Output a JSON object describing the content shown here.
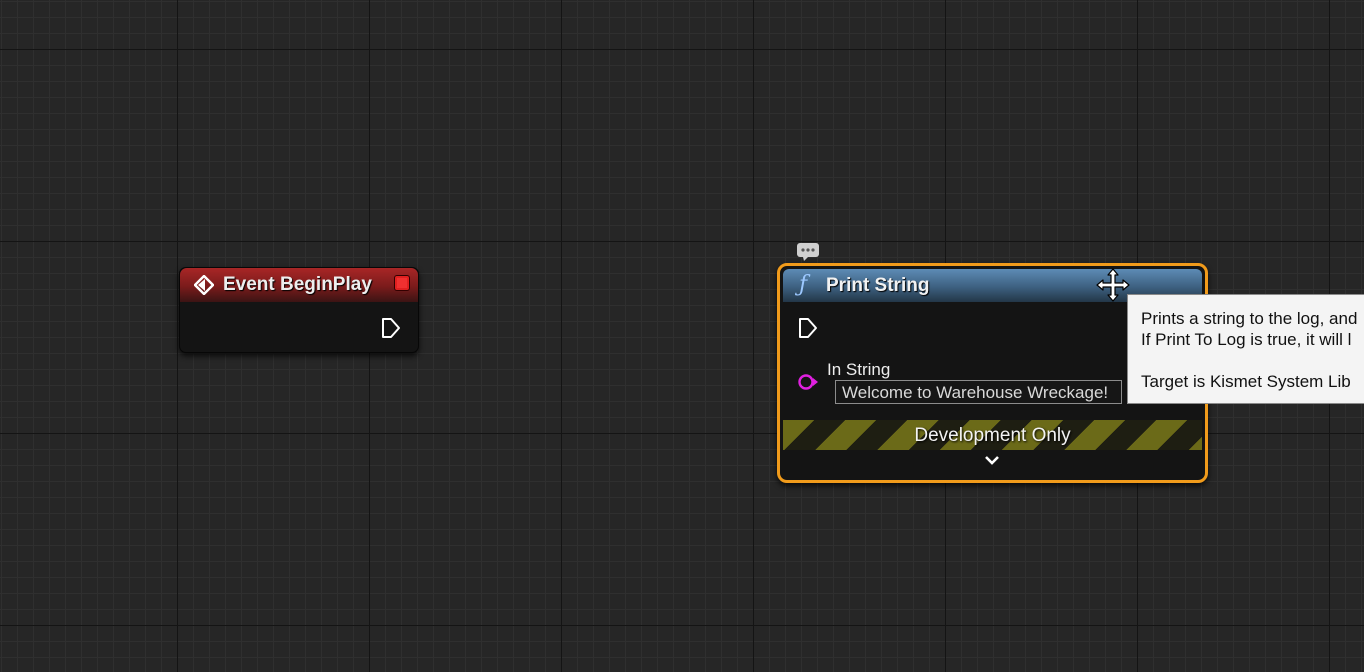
{
  "event_node": {
    "title": "Event BeginPlay",
    "header_color": "#a82626"
  },
  "print_node": {
    "title": "Print String",
    "header_color": "#3d6080",
    "selection_outline_color": "#f19b1b",
    "in_string_label": "In String",
    "in_string_value": "Welcome to Warehouse Wreckage!",
    "string_pin_color": "#e020e0",
    "development_label": "Development Only"
  },
  "tooltip": {
    "line1": "Prints a string to the log, and",
    "line2": "If Print To Log is true, it will l",
    "line3": "Target is Kismet System Lib"
  }
}
